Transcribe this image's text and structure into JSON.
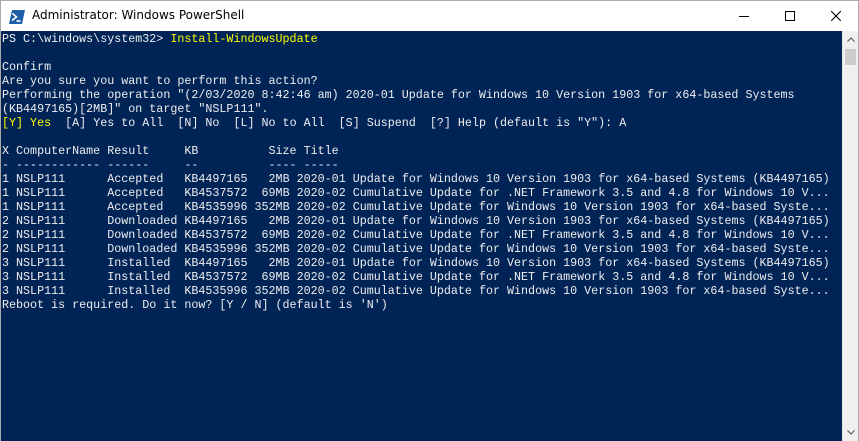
{
  "window": {
    "title": "Administrator: Windows PowerShell",
    "icon": "powershell-icon",
    "controls": [
      "minimize-icon",
      "maximize-icon",
      "close-icon"
    ]
  },
  "colors": {
    "console_background": "#012456",
    "console_text": "#eeedf0",
    "command_text": "#ffff00"
  },
  "console": {
    "prompt": "PS C:\\windows\\system32> ",
    "command": "Install-WindowsUpdate",
    "blank_1": "",
    "confirm_header": "Confirm",
    "question": "Are you sure you want to perform this action?",
    "operation_line_1": "Performing the operation \"(2/03/2020 8:42:46 am) 2020-01 Update for Windows 10 Version 1903 for x64-based Systems",
    "operation_line_2": "(KB4497165)[2MB]\" on target \"NSLP111\".",
    "choice_default": "[Y] Yes",
    "choice_rest": "  [A] Yes to All  [N] No  [L] No to All  [S] Suspend  [?] Help (default is \"Y\"): A",
    "blank_2": "",
    "table_header": "X ComputerName Result     KB          Size Title",
    "table_separator": "- ------------ ------     --          ---- -----",
    "table_rows": [
      {
        "x": "1",
        "computer": "NSLP111",
        "result": "Accepted",
        "kb": "KB4497165",
        "size": "2MB",
        "title": "2020-01 Update for Windows 10 Version 1903 for x64-based Systems (KB4497165)"
      },
      {
        "x": "1",
        "computer": "NSLP111",
        "result": "Accepted",
        "kb": "KB4537572",
        "size": "69MB",
        "title": "2020-02 Cumulative Update for .NET Framework 3.5 and 4.8 for Windows 10 V..."
      },
      {
        "x": "1",
        "computer": "NSLP111",
        "result": "Accepted",
        "kb": "KB4535996",
        "size": "352MB",
        "title": "2020-02 Cumulative Update for Windows 10 Version 1903 for x64-based Syste..."
      },
      {
        "x": "2",
        "computer": "NSLP111",
        "result": "Downloaded",
        "kb": "KB4497165",
        "size": "2MB",
        "title": "2020-01 Update for Windows 10 Version 1903 for x64-based Systems (KB4497165)"
      },
      {
        "x": "2",
        "computer": "NSLP111",
        "result": "Downloaded",
        "kb": "KB4537572",
        "size": "69MB",
        "title": "2020-02 Cumulative Update for .NET Framework 3.5 and 4.8 for Windows 10 V..."
      },
      {
        "x": "2",
        "computer": "NSLP111",
        "result": "Downloaded",
        "kb": "KB4535996",
        "size": "352MB",
        "title": "2020-02 Cumulative Update for Windows 10 Version 1903 for x64-based Syste..."
      },
      {
        "x": "3",
        "computer": "NSLP111",
        "result": "Installed",
        "kb": "KB4497165",
        "size": "2MB",
        "title": "2020-01 Update for Windows 10 Version 1903 for x64-based Systems (KB4497165)"
      },
      {
        "x": "3",
        "computer": "NSLP111",
        "result": "Installed",
        "kb": "KB4537572",
        "size": "69MB",
        "title": "2020-02 Cumulative Update for .NET Framework 3.5 and 4.8 for Windows 10 V..."
      },
      {
        "x": "3",
        "computer": "NSLP111",
        "result": "Installed",
        "kb": "KB4535996",
        "size": "352MB",
        "title": "2020-02 Cumulative Update for Windows 10 Version 1903 for x64-based Syste..."
      }
    ],
    "reboot_prompt": "Reboot is required. Do it now? [Y / N] (default is 'N')"
  }
}
